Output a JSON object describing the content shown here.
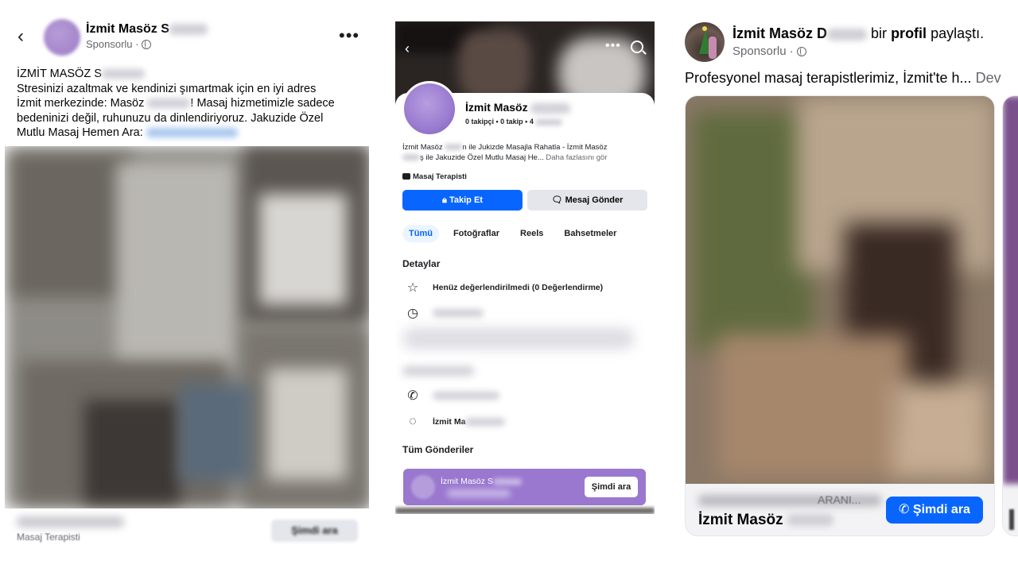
{
  "panel1": {
    "header": {
      "back_icon": "‹",
      "name": "İzmit Masöz S",
      "sponsored": "Sponsorlu ·",
      "more_icon": "•••"
    },
    "caption": {
      "line1": "İZMİT MASÖZ S",
      "line2": "Stresinizi azaltmak ve kendinizi şımartmak için en iyi adres",
      "line3a": "İzmit merkezinde: Masöz ",
      "line3b": "! Masaj hizmetimizle sadece",
      "line4": "bedeninizi değil, ruhunuzu da dinlendiriyoruz. Jakuzide Özel",
      "line5": "Mutlu Masaj Hemen Ara: "
    },
    "footer": {
      "category": "Masaj Terapisti",
      "call_button": "Şimdi ara"
    }
  },
  "panel2": {
    "profile_name": "İzmit Masöz",
    "stats": "0 takipçi • 0 takip • 4",
    "bio_part1": "İzmit Masöz ",
    "bio_part2": "n ile Jukizde Masajla Rahatla - İzmit Masöz",
    "bio_part3": "ş ile Jakuzide Özel Mutlu Masaj He...",
    "bio_more": "Daha fazlasını gör",
    "category": "Masaj Terapisti",
    "follow_button": "Takip Et",
    "message_button": "Mesaj Gönder",
    "tabs": [
      "Tümü",
      "Fotoğraflar",
      "Reels",
      "Bahsetmeler"
    ],
    "details_title": "Detaylar",
    "rating_text": "Henüz değerlendirilmedi (0 Değerlendirme)",
    "messenger_name": "İzmit Ma",
    "all_posts_title": "Tüm Gönderiler",
    "callbar_name": "İzmit Masöz S",
    "callbar_button": "Şimdi ara"
  },
  "panel3": {
    "title_name": "İzmit Masöz D",
    "title_mid": "bir",
    "title_profile": "profil",
    "title_end": "paylaştı.",
    "sponsored": "Sponsorlu ·",
    "caption": "Profesyonel masaj terapistlerimiz, İzmit'te h...",
    "caption_more": "Dev",
    "card_aran": "ARANI...",
    "card_name": "İzmit Masöz",
    "card_call": "Şimdi ara"
  }
}
